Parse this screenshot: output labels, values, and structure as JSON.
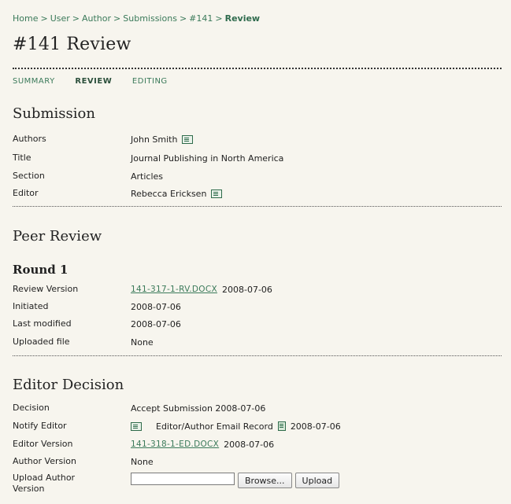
{
  "breadcrumb": {
    "items": [
      "Home",
      "User",
      "Author",
      "Submissions",
      "#141"
    ],
    "separator": ">",
    "current": "Review"
  },
  "title": "#141 Review",
  "tabs": [
    {
      "label": "SUMMARY"
    },
    {
      "label": "REVIEW",
      "active": true
    },
    {
      "label": "EDITING"
    }
  ],
  "submission": {
    "heading": "Submission",
    "authors_label": "Authors",
    "authors_value": "John Smith",
    "title_label": "Title",
    "title_value": "Journal Publishing in North America",
    "section_label": "Section",
    "section_value": "Articles",
    "editor_label": "Editor",
    "editor_value": "Rebecca Ericksen"
  },
  "peer_review": {
    "heading": "Peer Review",
    "round": "Round 1",
    "review_version_label": "Review Version",
    "review_version_file": "141-317-1-RV.DOCX",
    "review_version_date": "2008-07-06",
    "initiated_label": "Initiated",
    "initiated_value": "2008-07-06",
    "last_modified_label": "Last modified",
    "last_modified_value": "2008-07-06",
    "uploaded_file_label": "Uploaded file",
    "uploaded_file_value": "None"
  },
  "editor_decision": {
    "heading": "Editor Decision",
    "decision_label": "Decision",
    "decision_value": "Accept Submission 2008-07-06",
    "notify_label": "Notify Editor",
    "notify_record": "Editor/Author Email Record",
    "notify_date": "2008-07-06",
    "editor_version_label": "Editor Version",
    "editor_version_file": "141-318-1-ED.DOCX",
    "editor_version_date": "2008-07-06",
    "author_version_label": "Author Version",
    "author_version_value": "None",
    "upload_label_line1": "Upload Author",
    "upload_label_line2": "Version",
    "browse_label": "Browse...",
    "upload_button": "Upload"
  },
  "icons": {
    "email": "mail-icon",
    "record": "document-icon"
  },
  "colors": {
    "background": "#f7f5ee",
    "link": "#3b7a5a"
  }
}
